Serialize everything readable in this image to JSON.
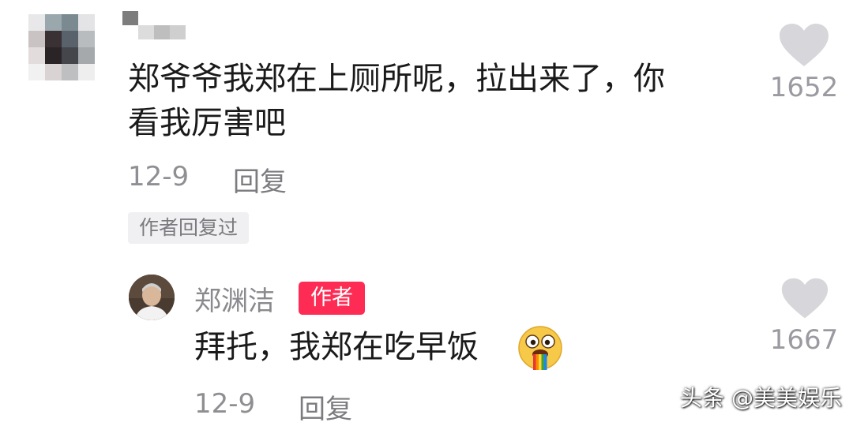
{
  "comment1": {
    "text_line1": "郑爷爷我郑在上厕所呢，拉出来了，你",
    "text_line2": "看我厉害吧",
    "date": "12-9",
    "reply_label": "回复",
    "author_replied_badge": "作者回复过",
    "like_count": "1652",
    "like_icon": "heart-icon"
  },
  "reply": {
    "author_name": "郑渊洁",
    "author_badge": "作者",
    "text": "拜托，我郑在吃早饭",
    "emoji": "vomiting-rainbow-emoji",
    "date": "12-9",
    "reply_label": "回复",
    "like_count": "1667",
    "like_icon": "heart-icon"
  },
  "watermark": "头条 @美美娱乐",
  "colors": {
    "author_badge_bg": "#fe2c55",
    "heart": "#d7d7db",
    "meta_text": "#8e8e93"
  }
}
